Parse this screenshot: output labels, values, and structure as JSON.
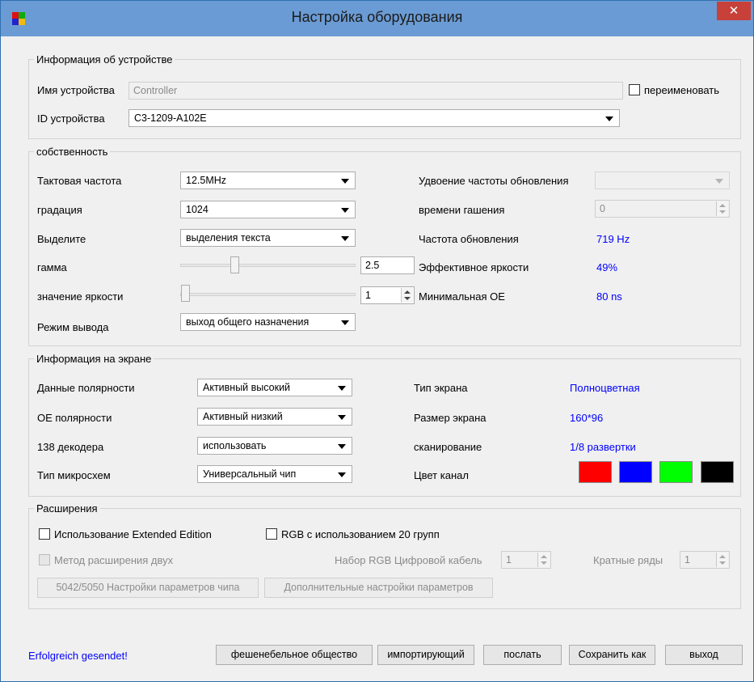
{
  "window": {
    "title": "Настройка оборудования",
    "close_symbol": "✕"
  },
  "device_info": {
    "legend": "Информация об устройстве",
    "name_label": "Имя устройства",
    "name_value": "Controller",
    "rename_label": "переименовать",
    "id_label": "ID устройства",
    "id_value": "C3-1209-A102E"
  },
  "properties": {
    "legend": "собственность",
    "clock_label": "Тактовая частота",
    "clock_value": "12.5MHz",
    "gradation_label": "градация",
    "gradation_value": "1024",
    "select_label": "Выделите",
    "select_value": "выделения текста",
    "gamma_label": "гамма",
    "gamma_value": "2.5",
    "brightness_label": "значение яркости",
    "brightness_value": "1",
    "output_label": "Режим вывода",
    "output_value": "выход общего назначения",
    "refresh_doubling_label": "Удвоение частоты обновления",
    "refresh_doubling_value": "",
    "blanking_label": "времени гашения",
    "blanking_value": "0",
    "refresh_rate_label": "Частота обновления",
    "refresh_rate_value": "719 Hz",
    "effective_brightness_label": "Эффективное яркости",
    "effective_brightness_value": "49%",
    "min_oe_label": "Минимальная OE",
    "min_oe_value": "80 ns",
    "gamma_slider_fraction": 0.3,
    "brightness_slider_fraction": 0.0
  },
  "screen_info": {
    "legend": "Информация на экране",
    "data_polarity_label": "Данные полярности",
    "data_polarity_value": "Активный высокий",
    "oe_polarity_label": "OE полярности",
    "oe_polarity_value": "Активный низкий",
    "decoder_label": "138 декодера",
    "decoder_value": "использовать",
    "chip_type_label": "Тип микросхем",
    "chip_type_value": "Универсальный чип",
    "screen_type_label": "Тип экрана",
    "screen_type_value": "Полноцветная",
    "screen_size_label": "Размер экрана",
    "screen_size_value": "160*96",
    "scan_label": "сканирование",
    "scan_value": "1/8 развертки",
    "color_channel_label": "Цвет канал",
    "channel_colors": [
      "#ff0000",
      "#0000ff",
      "#00ff00",
      "#000000"
    ]
  },
  "extensions": {
    "legend": "Расширения",
    "extended_edition_label": "Использование Extended Edition",
    "rgb20_label": "RGB с использованием 20 групп",
    "method_two_label": "Метод расширения двух",
    "rgb_digital_cable_label": "Набор RGB Цифровой кабель",
    "rgb_digital_cable_value": "1",
    "multiple_rows_label": "Кратные ряды",
    "multiple_rows_value": "1",
    "chip_settings_button": "5042/5050 Настройки параметров чипа",
    "extra_settings_button": "Дополнительные настройки параметров"
  },
  "footer": {
    "status": "Erfolgreich gesendet!",
    "btn_society": "фешенебельное общество",
    "btn_import": "импортирующий",
    "btn_send": "послать",
    "btn_save_as": "Сохранить как",
    "btn_exit": "выход"
  }
}
